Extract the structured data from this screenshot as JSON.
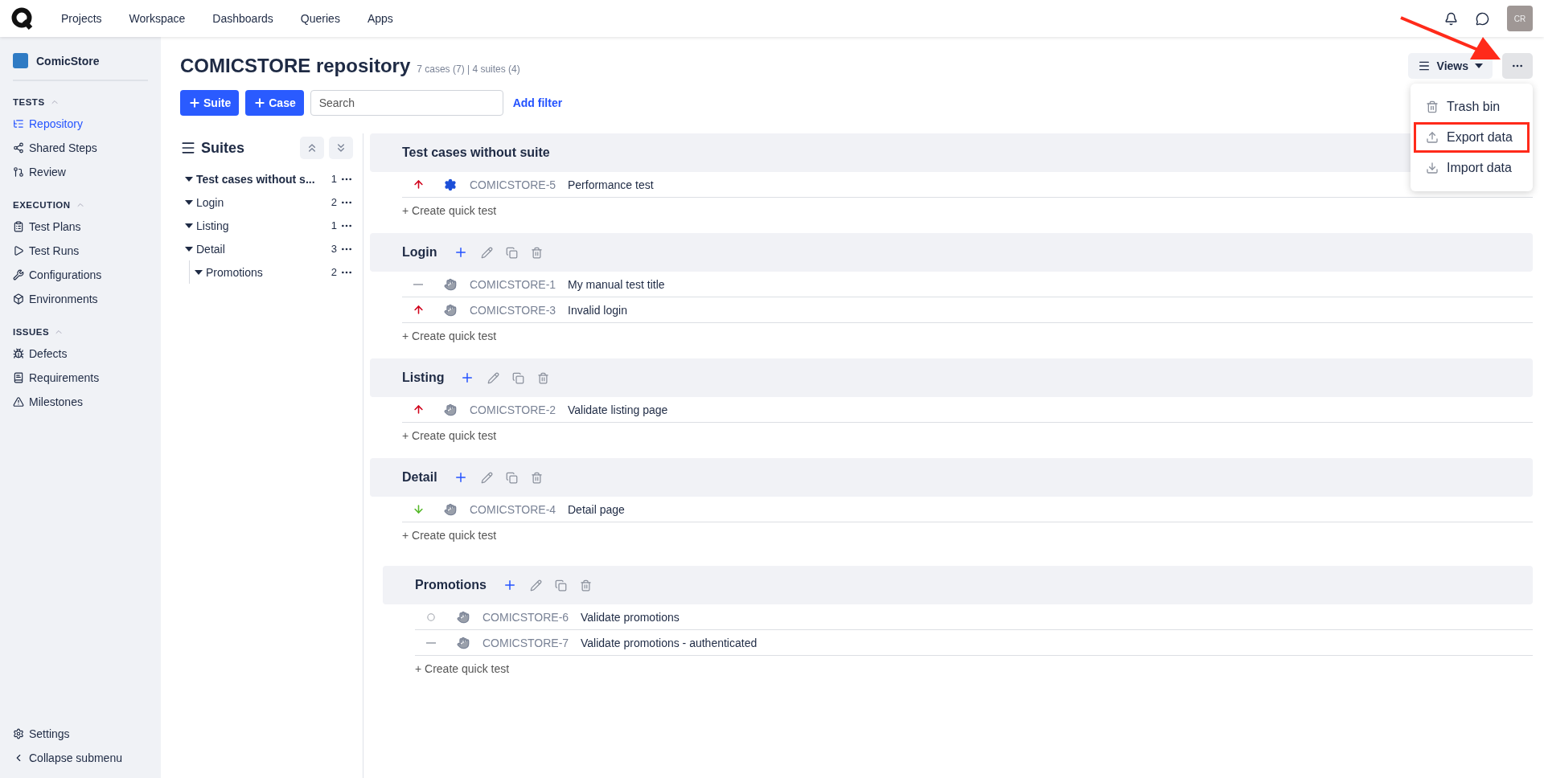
{
  "top_nav": {
    "items": [
      {
        "label": "Projects",
        "selected": false
      },
      {
        "label": "Workspace",
        "selected": false
      },
      {
        "label": "Dashboards",
        "selected": false
      },
      {
        "label": "Queries",
        "selected": false
      },
      {
        "label": "Apps",
        "selected": false
      }
    ],
    "avatar": "CR"
  },
  "sidebar": {
    "project": "ComicStore",
    "groups": [
      {
        "title": "TESTS",
        "expanded": true,
        "items": [
          {
            "label": "Repository",
            "selected": true
          },
          {
            "label": "Shared Steps",
            "selected": false
          },
          {
            "label": "Review",
            "selected": false
          }
        ]
      },
      {
        "title": "EXECUTION",
        "expanded": true,
        "items": [
          {
            "label": "Test Plans",
            "selected": false
          },
          {
            "label": "Test Runs",
            "selected": false
          },
          {
            "label": "Configurations",
            "selected": false
          },
          {
            "label": "Environments",
            "selected": false
          }
        ]
      },
      {
        "title": "ISSUES",
        "expanded": true,
        "items": [
          {
            "label": "Defects",
            "selected": false
          },
          {
            "label": "Requirements",
            "selected": false
          },
          {
            "label": "Milestones",
            "selected": false
          }
        ]
      }
    ],
    "footer": [
      "Settings",
      "Collapse submenu"
    ]
  },
  "page": {
    "title": "COMICSTORE repository",
    "counts": "7 cases (7) | 4 suites (4)",
    "buttons": [
      "Suite",
      "Case"
    ],
    "search": {
      "placeholder": "Search"
    },
    "add_filter": "Add filter",
    "views": "Views"
  },
  "menu": {
    "open": true,
    "items": [
      {
        "label": "Trash bin",
        "highlighted": false
      },
      {
        "label": "Export data",
        "highlighted": true
      },
      {
        "label": "Import data",
        "highlighted": false
      }
    ]
  },
  "annotation_arrow": true,
  "suites_panel": {
    "title": "Suites",
    "tree": [
      {
        "label": "Test cases without s...",
        "count": "1",
        "expanded": true,
        "bold": true
      },
      {
        "label": "Login",
        "count": "2",
        "expanded": true,
        "bold": false
      },
      {
        "label": "Listing",
        "count": "1",
        "expanded": true,
        "bold": false
      },
      {
        "label": "Detail",
        "count": "3",
        "expanded": true,
        "bold": false,
        "children": [
          {
            "label": "Promotions",
            "count": "2",
            "expanded": true,
            "bold": false
          }
        ]
      }
    ]
  },
  "sections": [
    {
      "title": "Test cases without suite",
      "editable": false,
      "cases": [
        {
          "priority": {
            "kind": "high"
          },
          "type": {
            "kind": "automated"
          },
          "id": "COMICSTORE-5",
          "title": "Performance test"
        }
      ],
      "quick_test": "+ Create quick test"
    },
    {
      "title": "Login",
      "editable": true,
      "cases": [
        {
          "priority": {
            "kind": "none"
          },
          "type": {
            "kind": "manual"
          },
          "id": "COMICSTORE-1",
          "title": "My manual test title"
        },
        {
          "priority": {
            "kind": "high"
          },
          "type": {
            "kind": "manual"
          },
          "id": "COMICSTORE-3",
          "title": "Invalid login"
        }
      ],
      "quick_test": "+ Create quick test"
    },
    {
      "title": "Listing",
      "editable": true,
      "cases": [
        {
          "priority": {
            "kind": "high"
          },
          "type": {
            "kind": "manual"
          },
          "id": "COMICSTORE-2",
          "title": "Validate listing page"
        }
      ],
      "quick_test": "+ Create quick test"
    },
    {
      "title": "Detail",
      "editable": true,
      "cases": [
        {
          "priority": {
            "kind": "low"
          },
          "type": {
            "kind": "manual"
          },
          "id": "COMICSTORE-4",
          "title": "Detail page"
        }
      ],
      "quick_test": "+ Create quick test",
      "children": [
        {
          "title": "Promotions",
          "editable": true,
          "cases": [
            {
              "priority": {
                "kind": "normal"
              },
              "type": {
                "kind": "manual"
              },
              "id": "COMICSTORE-6",
              "title": "Validate promotions"
            },
            {
              "priority": {
                "kind": "none"
              },
              "type": {
                "kind": "manual"
              },
              "id": "COMICSTORE-7",
              "title": "Validate promotions - authenticated"
            }
          ],
          "quick_test": "+ Create quick test"
        }
      ]
    }
  ]
}
